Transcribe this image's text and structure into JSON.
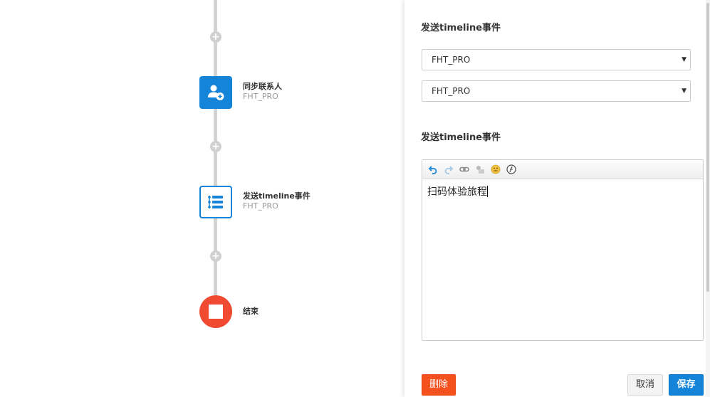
{
  "flow": {
    "add_symbol": "+",
    "nodes": [
      {
        "title": "同步联系人",
        "subtitle": "FHT_PRO",
        "icon": "add-contact-icon",
        "color": "#1484d8"
      },
      {
        "title": "发送timeline事件",
        "subtitle": "FHT_PRO",
        "icon": "timeline-list-icon",
        "color": "#1484d8"
      },
      {
        "title": "结束",
        "icon": "stop-icon",
        "color": "#f04a32"
      }
    ]
  },
  "panel": {
    "section1_title": "发送timeline事件",
    "select1_value": "FHT_PRO",
    "select2_value": "FHT_PRO",
    "section2_title": "发送timeline事件",
    "editor": {
      "toolbar": [
        "undo-icon",
        "redo-icon",
        "link-icon",
        "insert-field-icon",
        "emoji-icon",
        "special-char-icon"
      ],
      "content": "扫码体验旅程"
    },
    "buttons": {
      "delete_label": "删除",
      "cancel_label": "取消",
      "save_label": "保存"
    }
  },
  "colors": {
    "primary": "#1484d8",
    "danger": "#f4511e",
    "end_node": "#f04a32"
  }
}
